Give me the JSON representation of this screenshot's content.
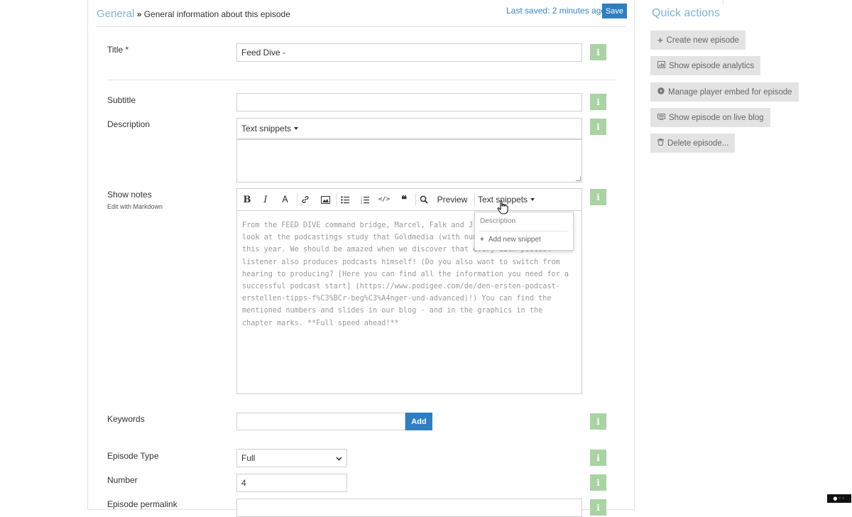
{
  "breadcrumb": {
    "link": "General",
    "separator": "»",
    "title": "General information about this episode"
  },
  "save_status": {
    "text": "Last saved: 2 minutes ago",
    "button": "Save"
  },
  "fields": {
    "title": {
      "label": "Title *",
      "value": "Feed Dive -"
    },
    "subtitle": {
      "label": "Subtitle",
      "value": ""
    },
    "description": {
      "label": "Description",
      "snippets_label": "Text snippets",
      "value": ""
    },
    "show_notes": {
      "label": "Show notes",
      "sublabel": "Edit with Markdown",
      "preview_label": "Preview",
      "snippets_label": "Text snippets",
      "lines": [
        "From the FEED DIVE command bridge, Marcel, Falk and J",
        "look at the podcastings study that Goldmedia (with num",
        "this year. We should be amazed when we discover that every 12th podcast",
        "listener also produces podcasts himself! (Do you also want to switch from",
        "hearing to producing? [Here you can find all the information you need for a",
        "successful podcast start] (https://www.podigee.com/de/den-ersten-podcast-",
        "erstellen-tipps-f%C3%BCr-beg%C3%A4nger-und-advanced)!) You can find the",
        "mentioned numbers and slides in our blog - and in the graphics in the",
        "chapter marks. **Full speed ahead!**"
      ]
    },
    "keywords": {
      "label": "Keywords",
      "value": "",
      "add_button": "Add"
    },
    "episode_type": {
      "label": "Episode Type",
      "selected": "Full"
    },
    "number": {
      "label": "Number",
      "value": "4"
    },
    "permalink": {
      "label": "Episode permalink"
    }
  },
  "info_icon": "i",
  "snippets_dropdown": {
    "header": "Description",
    "add_item": "Add new snippet"
  },
  "quick_actions": {
    "title": "Quick actions",
    "buttons": [
      {
        "icon": "plus-icon",
        "label": "Create new episode"
      },
      {
        "icon": "chart-icon",
        "label": "Show episode analytics"
      },
      {
        "icon": "play-circle-icon",
        "label": "Manage player embed for episode"
      },
      {
        "icon": "monitor-icon",
        "label": "Show episode on live blog"
      },
      {
        "icon": "trash-icon",
        "label": "Delete episode..."
      }
    ]
  },
  "colors": {
    "accent": "#2f7ec1",
    "link": "#7fb2d9",
    "info_button": "#a9d3a3",
    "sidebar_button": "#e3e3e3"
  }
}
